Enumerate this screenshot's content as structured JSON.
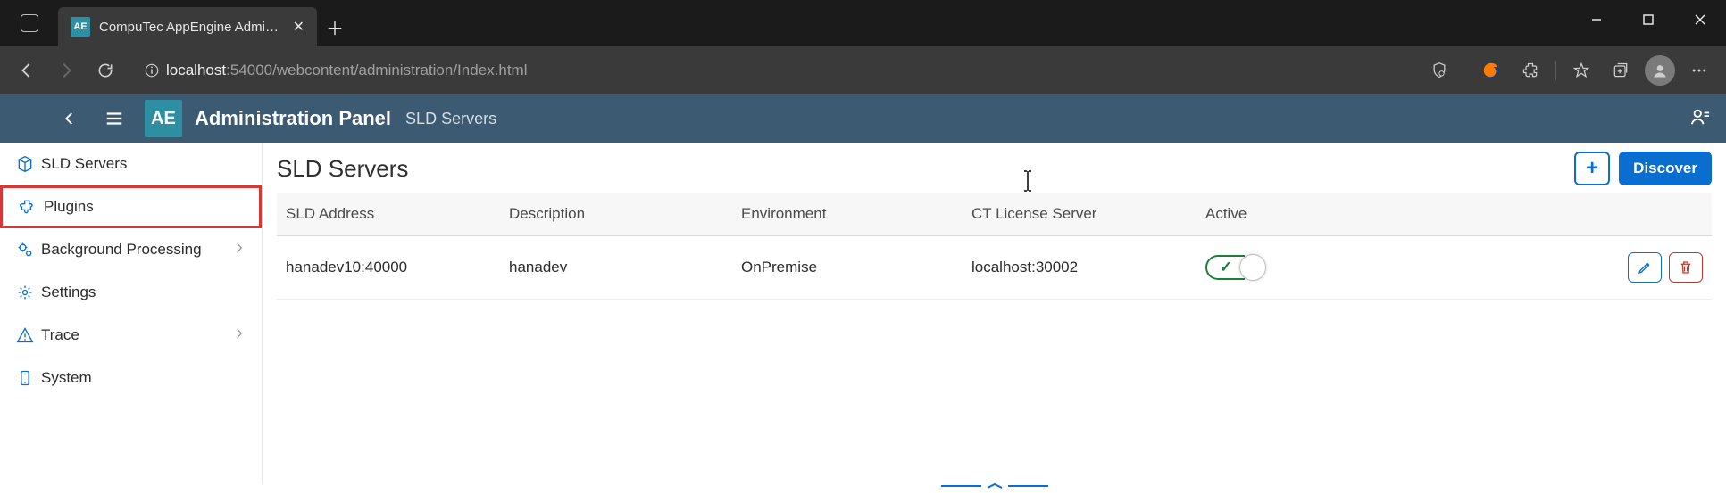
{
  "browser": {
    "tab_title": "CompuTec AppEngine Administr",
    "tab_favicon_text": "AE",
    "url_host": "localhost",
    "url_port": ":54000",
    "url_path": "/webcontent/administration/Index.html"
  },
  "header": {
    "logo_text": "AE",
    "title": "Administration Panel",
    "breadcrumb": "SLD Servers"
  },
  "sidebar": {
    "items": [
      {
        "label": "SLD Servers",
        "has_chevron": false
      },
      {
        "label": "Plugins",
        "has_chevron": false,
        "selected": true
      },
      {
        "label": "Background Processing",
        "has_chevron": true
      },
      {
        "label": "Settings",
        "has_chevron": false
      },
      {
        "label": "Trace",
        "has_chevron": true
      },
      {
        "label": "System",
        "has_chevron": false
      }
    ]
  },
  "page": {
    "title": "SLD Servers",
    "add_label": "+",
    "discover_label": "Discover"
  },
  "table": {
    "columns": {
      "addr": "SLD Address",
      "desc": "Description",
      "env": "Environment",
      "lic": "CT License Server",
      "act": "Active"
    },
    "rows": [
      {
        "addr": "hanadev10:40000",
        "desc": "hanadev",
        "env": "OnPremise",
        "lic": "localhost:30002",
        "active": true
      }
    ]
  }
}
